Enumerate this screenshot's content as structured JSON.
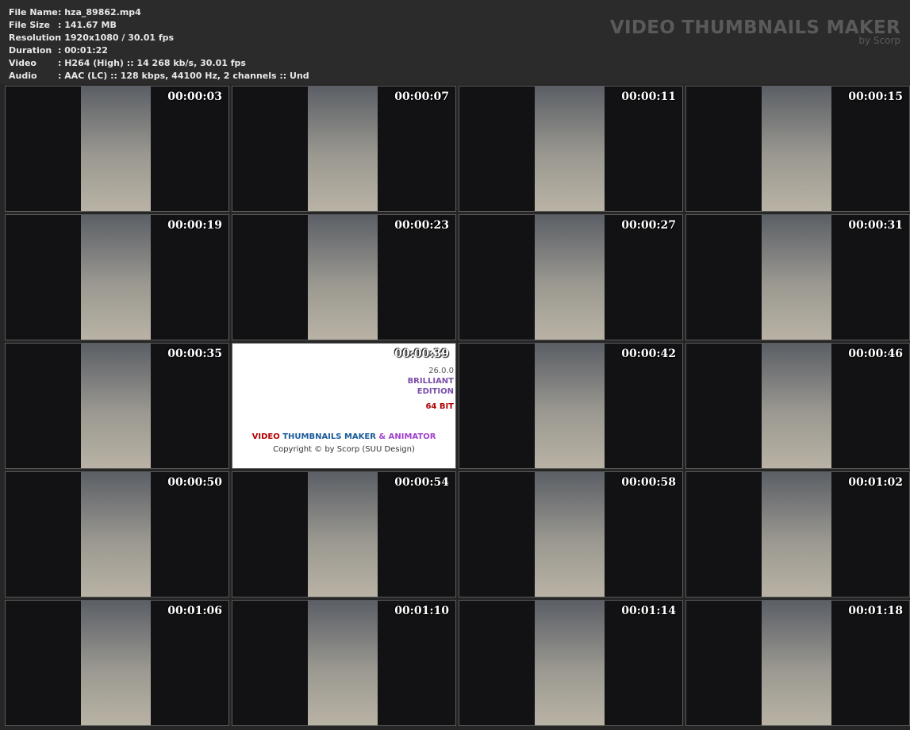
{
  "info": [
    {
      "key": "File Name",
      "value": ": hza_89862.mp4"
    },
    {
      "key": "File Size",
      "value": ": 141.67 MB"
    },
    {
      "key": "Resolution",
      "value": ": 1920x1080 / 30.01 fps"
    },
    {
      "key": "Duration",
      "value": ": 00:01:22"
    },
    {
      "key": "Video",
      "value": ": H264 (High) :: 14 268 kb/s, 30.01 fps"
    },
    {
      "key": "Audio",
      "value": ": AAC (LC) :: 128 kbps, 44100 Hz, 2 channels :: Und"
    }
  ],
  "brand": {
    "title": "VIDEO THUMBNAILS MAKER",
    "by": "by Scorp"
  },
  "splash": {
    "version": "26.0.0",
    "edition1": "BRILLIANT",
    "edition2": "EDITION",
    "bits": "64 BIT",
    "w1": "VIDEO",
    "w2": "THUMBNAILS MAKER",
    "w3": "& ANIMATOR",
    "copyright": "Copyright © by Scorp (SUU Design)"
  },
  "thumbs": [
    "00:00:03",
    "00:00:07",
    "00:00:11",
    "00:00:15",
    "00:00:19",
    "00:00:23",
    "00:00:27",
    "00:00:31",
    "00:00:35",
    "00:00:39",
    "00:00:42",
    "00:00:46",
    "00:00:50",
    "00:00:54",
    "00:00:58",
    "00:01:02",
    "00:01:06",
    "00:01:10",
    "00:01:14",
    "00:01:18"
  ]
}
